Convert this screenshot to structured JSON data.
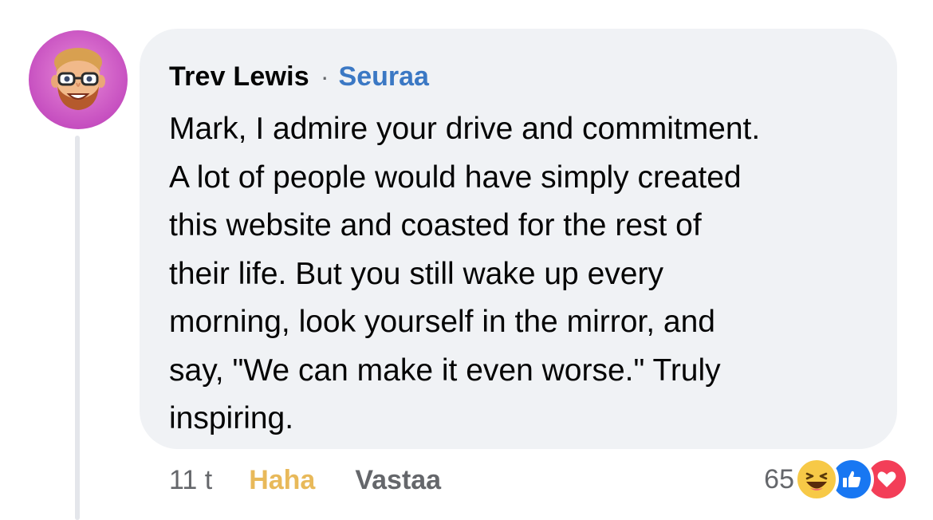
{
  "comment": {
    "author": "Trev Lewis",
    "separator": "·",
    "follow_label": "Seuraa",
    "text_lines": [
      "Mark, I admire your drive and commitment.",
      "A lot of people would have simply created",
      "this website and coasted for the rest of",
      "their life. But you still wake up every",
      "morning, look yourself in the mirror, and",
      "say, \"We can make it even worse.\" Truly",
      "inspiring."
    ]
  },
  "actions": {
    "timestamp": "11 t",
    "reaction_label": "Haha",
    "reply_label": "Vastaa"
  },
  "reactions": {
    "count": "65",
    "icons": [
      "haha-icon",
      "like-icon",
      "love-icon"
    ]
  },
  "colors": {
    "follow": "#3b78c4",
    "haha_active": "#e8b95a",
    "bubble": "#f0f2f5",
    "like": "#1877f2",
    "love": "#f33e58",
    "haha": "#f7c947"
  }
}
